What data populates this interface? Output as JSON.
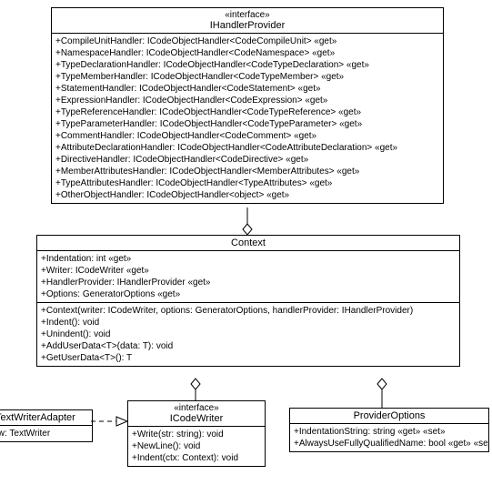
{
  "ihandler": {
    "stereo": "«interface»",
    "name": "IHandlerProvider",
    "props": [
      "+CompileUnitHandler: ICodeObjectHandler<CodeCompileUnit> «get»",
      "+NamespaceHandler: ICodeObjectHandler<CodeNamespace> «get»",
      "+TypeDeclarationHandler: ICodeObjectHandler<CodeTypeDeclaration> «get»",
      "+TypeMemberHandler: ICodeObjectHandler<CodeTypeMember> «get»",
      "+StatementHandler: ICodeObjectHandler<CodeStatement> «get»",
      "+ExpressionHandler: ICodeObjectHandler<CodeExpression> «get»",
      "+TypeReferenceHandler: ICodeObjectHandler<CodeTypeReference> «get»",
      "+TypeParameterHandler: ICodeObjectHandler<CodeTypeParameter> «get»",
      "+CommentHandler: ICodeObjectHandler<CodeComment> «get»",
      "+AttributeDeclarationHandler: ICodeObjectHandler<CodeAttributeDeclaration> «get»",
      "+DirectiveHandler: ICodeObjectHandler<CodeDirective> «get»",
      "+MemberAttributesHandler: ICodeObjectHandler<MemberAttributes> «get»",
      "+TypeAttributesHandler: ICodeObjectHandler<TypeAttributes> «get»",
      "+OtherObjectHandler: ICodeObjectHandler<object> «get»"
    ]
  },
  "context": {
    "name": "Context",
    "props": [
      "+Indentation: int «get»",
      "+Writer: ICodeWriter «get»",
      "+HandlerProvider: IHandlerProvider «get»",
      "+Options: GeneratorOptions «get»"
    ],
    "methods": [
      "+Context(writer: ICodeWriter, options: GeneratorOptions, handlerProvider: IHandlerProvider)",
      "+Indent(): void",
      "+Unindent(): void",
      "+AddUserData<T>(data: T): void",
      "+GetUserData<T>(): T"
    ]
  },
  "icodewriter": {
    "stereo": "«interface»",
    "name": "ICodeWriter",
    "methods": [
      "+Write(str: string): void",
      "+NewLine(): void",
      "+Indent(ctx: Context): void"
    ]
  },
  "provideroptions": {
    "name": "ProviderOptions",
    "props": [
      "+IndentationString: string «get» «set»",
      "+AlwaysUseFullyQualifiedName: bool «get» «set»"
    ]
  },
  "textwriteradapter": {
    "name": "TextWriterAdapter",
    "props": [
      "tw: TextWriter"
    ]
  }
}
